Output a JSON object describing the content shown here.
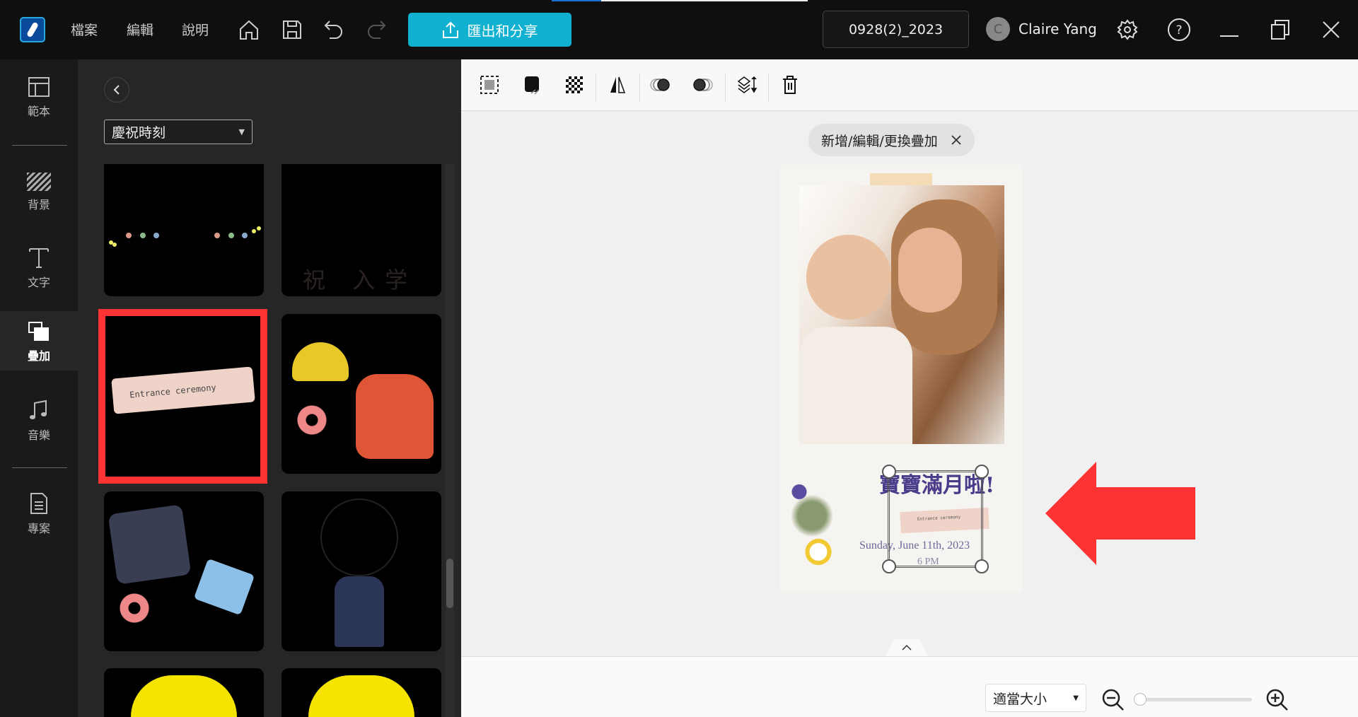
{
  "titlebar": {
    "menu": [
      "檔案",
      "編輯",
      "說明"
    ],
    "export_label": "匯出和分享",
    "project_name": "0928(2)_2023",
    "avatar_initial": "C",
    "user_name": "Claire Yang"
  },
  "rail": {
    "items": [
      {
        "label": "範本",
        "icon": "template-icon"
      },
      {
        "label": "背景",
        "icon": "background-icon"
      },
      {
        "label": "文字",
        "icon": "text-icon"
      },
      {
        "label": "疊加",
        "icon": "overlay-icon",
        "active": true
      },
      {
        "label": "音樂",
        "icon": "music-icon"
      },
      {
        "label": "專案",
        "icon": "project-icon"
      }
    ]
  },
  "panel": {
    "category": "慶祝時刻",
    "tiles": [
      {
        "name": "garland-overlay"
      },
      {
        "name": "entrance-celebration-overlay",
        "text": "祝 入学"
      },
      {
        "name": "entrance-ceremony-overlay",
        "text": "Entrance ceremony",
        "selected": true
      },
      {
        "name": "hat-backpack-overlay"
      },
      {
        "name": "uniform-overlay"
      },
      {
        "name": "student-overlay"
      },
      {
        "name": "yellow-hat-overlay"
      },
      {
        "name": "yellow-hat-overlay-2"
      }
    ]
  },
  "canvas": {
    "tooltip": "新增/編輯/更換疊加",
    "card": {
      "headline": "寶寶滿月啦!",
      "date": "Sunday, June 11th, 2023",
      "time": "6 PM",
      "sticker": "Entrance ceremony"
    }
  },
  "bottom": {
    "fit_option": "適當大小",
    "zoom_level": 0
  },
  "colors": {
    "accent": "#10b0d0",
    "highlight": "#ff3333"
  }
}
